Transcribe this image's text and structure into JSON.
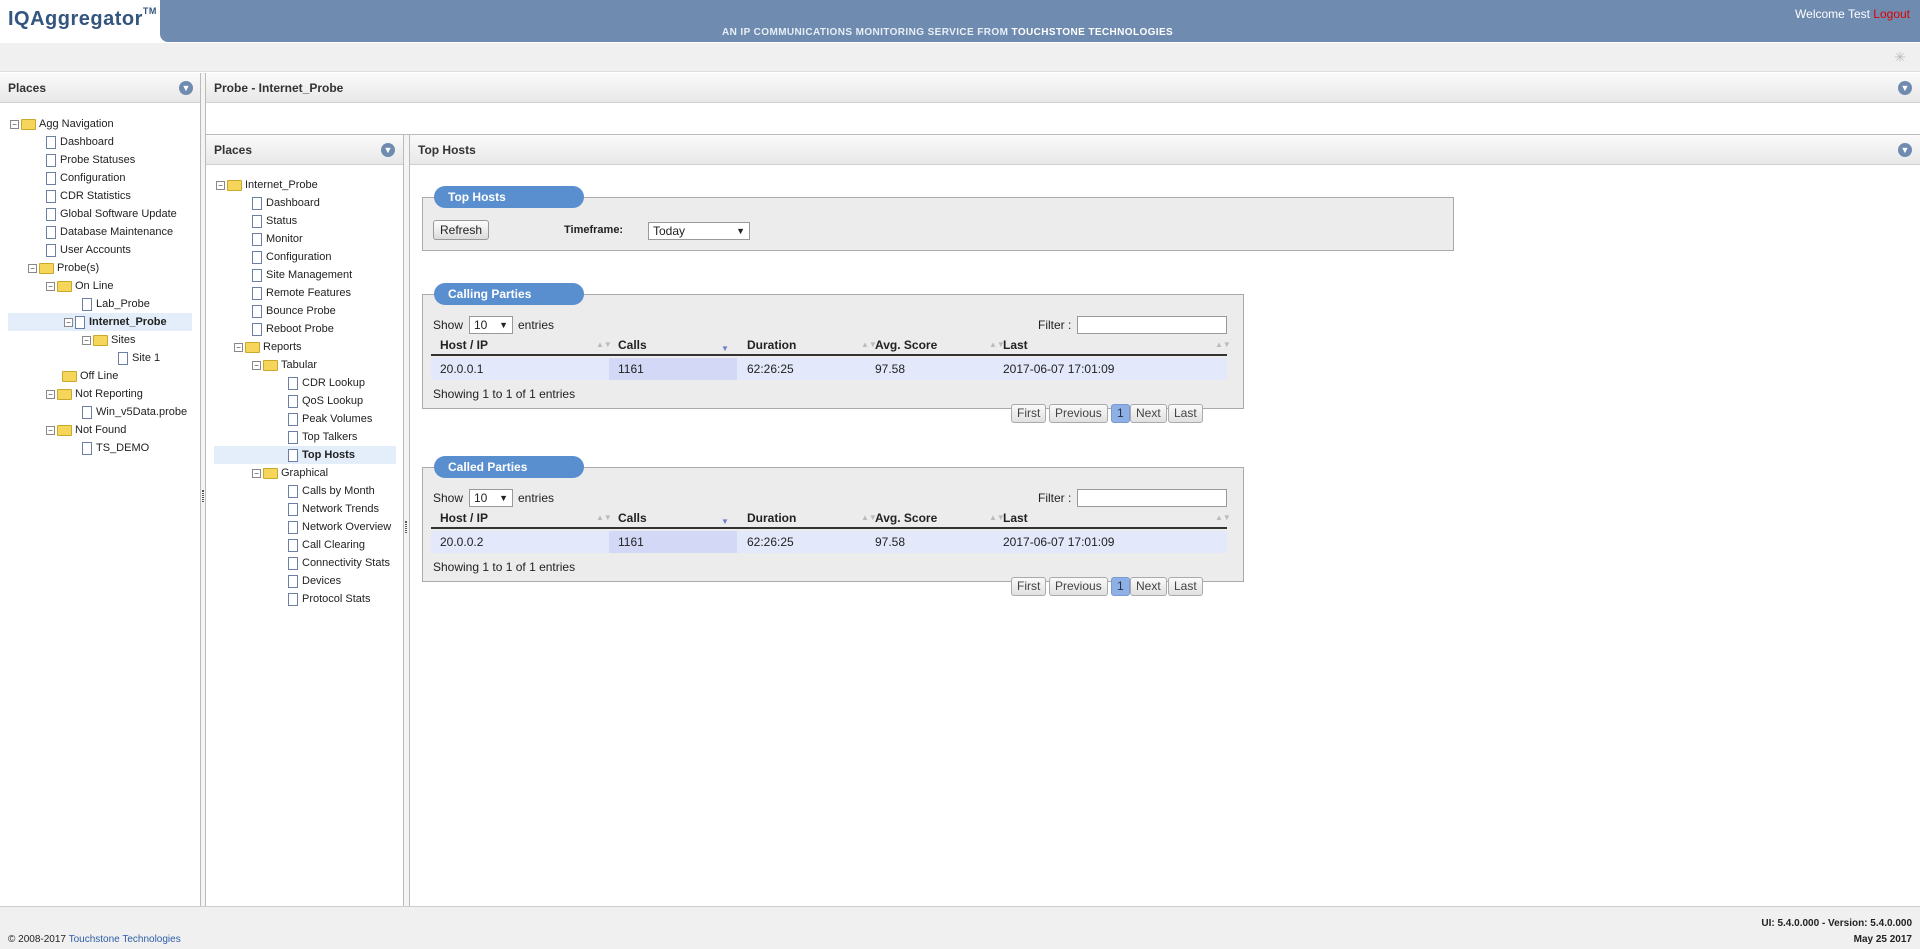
{
  "header": {
    "logo": "IQAggregator",
    "logo_tm": "TM",
    "tagline_pre": "AN IP COMMUNICATIONS MONITORING SERVICE FROM ",
    "tagline_brand": "TOUCHSTONE TECHNOLOGIES",
    "welcome": "Welcome Test ",
    "logout": "Logout"
  },
  "colors": {
    "header_bg": "#6f8cb0",
    "tab_pill": "#5a8fcf",
    "logout": "#dd0000",
    "selected_row": "#e4e8fb"
  },
  "left_panel": {
    "title": "Places",
    "tree": {
      "root": "Agg Navigation",
      "items": [
        "Dashboard",
        "Probe Statuses",
        "Configuration",
        "CDR Statistics",
        "Global Software Update",
        "Database Maintenance",
        "User Accounts"
      ],
      "probes": "Probe(s)",
      "online": "On Line",
      "lab_probe": "Lab_Probe",
      "internet_probe": "Internet_Probe",
      "sites": "Sites",
      "site1": "Site 1",
      "offline": "Off Line",
      "not_reporting": "Not Reporting",
      "win_probe": "Win_v5Data.probe",
      "not_found": "Not Found",
      "ts_demo": "TS_DEMO"
    }
  },
  "main_title": "Probe - Internet_Probe",
  "mid_panel": {
    "title": "Places",
    "tree": {
      "root": "Internet_Probe",
      "items": [
        "Dashboard",
        "Status",
        "Monitor",
        "Configuration",
        "Site Management",
        "Remote Features",
        "Bounce Probe",
        "Reboot Probe"
      ],
      "reports": "Reports",
      "tabular": "Tabular",
      "tabular_items": [
        "CDR Lookup",
        "QoS Lookup",
        "Peak Volumes",
        "Top Talkers",
        "Top Hosts"
      ],
      "graphical": "Graphical",
      "graphical_items": [
        "Calls by Month",
        "Network Trends",
        "Network Overview",
        "Call Clearing",
        "Connectivity Stats",
        "Devices",
        "Protocol Stats"
      ]
    }
  },
  "content": {
    "title": "Top Hosts",
    "top_hosts": {
      "tab": "Top Hosts",
      "refresh": "Refresh",
      "timeframe_label": "Timeframe:",
      "timeframe_value": "Today"
    },
    "calling": {
      "tab": "Calling Parties",
      "show": "Show",
      "entries_value": "10",
      "entries": "entries",
      "filter": "Filter :",
      "columns": [
        "Host / IP",
        "Calls",
        "Duration",
        "Avg. Score",
        "Last"
      ],
      "row": [
        "20.0.0.1",
        "1161",
        "62:26:25",
        "97.58",
        "2017-06-07 17:01:09"
      ],
      "info": "Showing 1 to 1 of 1 entries",
      "pager": [
        "First",
        "Previous",
        "1",
        "Next",
        "Last"
      ]
    },
    "called": {
      "tab": "Called Parties",
      "show": "Show",
      "entries_value": "10",
      "entries": "entries",
      "filter": "Filter :",
      "columns": [
        "Host / IP",
        "Calls",
        "Duration",
        "Avg. Score",
        "Last"
      ],
      "row": [
        "20.0.0.2",
        "1161",
        "62:26:25",
        "97.58",
        "2017-06-07 17:01:09"
      ],
      "info": "Showing 1 to 1 of 1 entries",
      "pager": [
        "First",
        "Previous",
        "1",
        "Next",
        "Last"
      ]
    }
  },
  "footer": {
    "copyright_pre": "© 2008-2017 ",
    "copyright_link": "Touchstone Technologies",
    "version": "UI: 5.4.0.000 - Version: 5.4.0.000",
    "date": "May 25 2017"
  }
}
